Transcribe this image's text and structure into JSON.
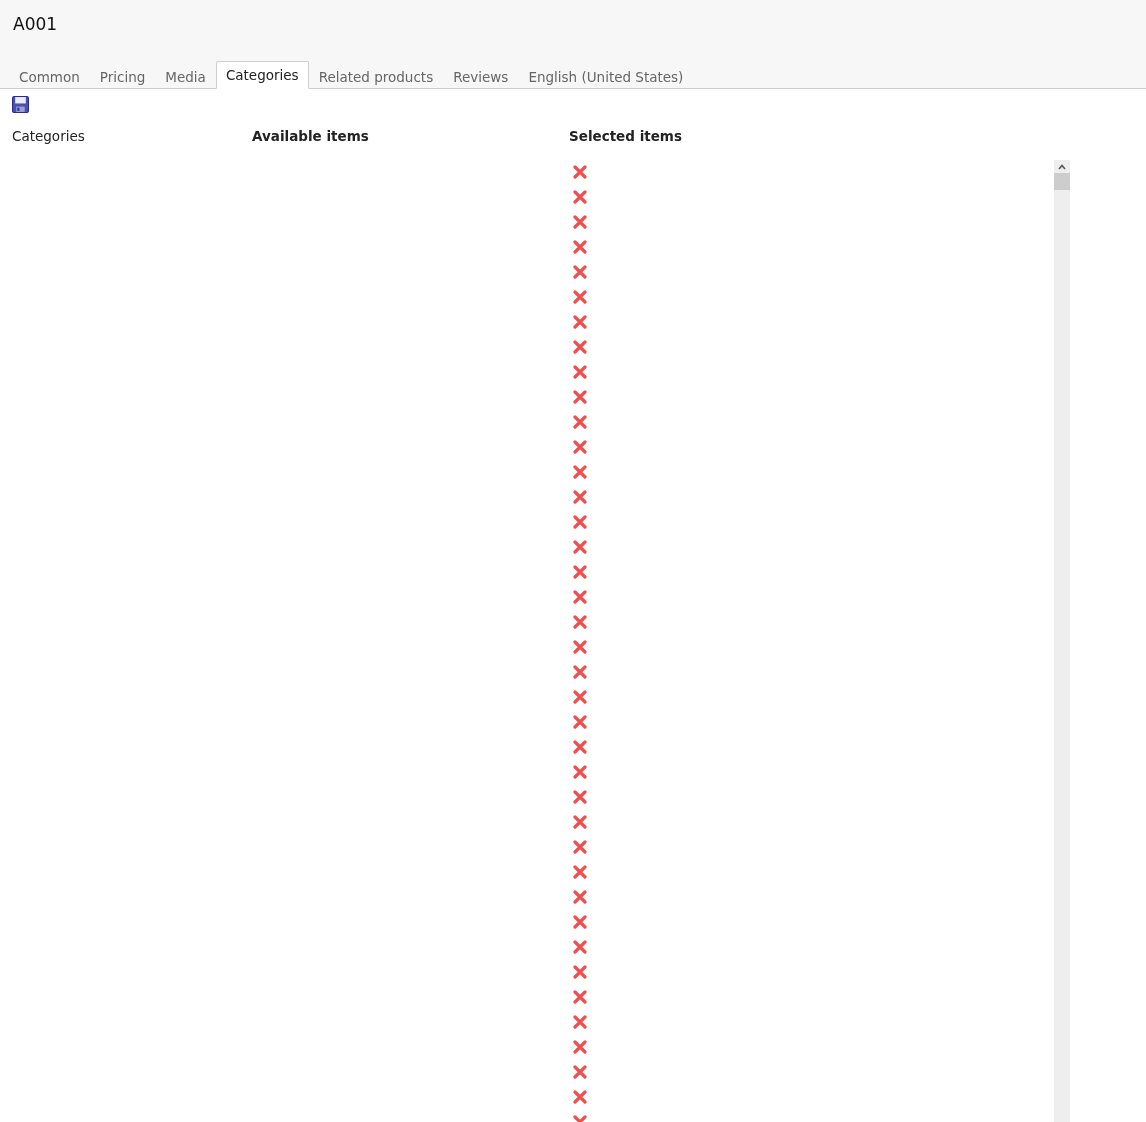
{
  "header": {
    "title": "A001"
  },
  "tabs": [
    {
      "label": "Common",
      "selected": false
    },
    {
      "label": "Pricing",
      "selected": false
    },
    {
      "label": "Media",
      "selected": false
    },
    {
      "label": "Categories",
      "selected": true
    },
    {
      "label": "Related products",
      "selected": false
    },
    {
      "label": "Reviews",
      "selected": false
    },
    {
      "label": "English (United States)",
      "selected": false
    }
  ],
  "columns": [
    {
      "label": "Categories",
      "kind": "plain"
    },
    {
      "label": "Available items",
      "kind": "heading"
    },
    {
      "label": "Selected items",
      "kind": "heading"
    }
  ],
  "selected_items": [
    {
      "removable": true
    },
    {
      "removable": true
    },
    {
      "removable": true
    },
    {
      "removable": true
    },
    {
      "removable": true
    },
    {
      "removable": true
    },
    {
      "removable": true
    },
    {
      "removable": true
    },
    {
      "removable": true
    },
    {
      "removable": true
    },
    {
      "removable": true
    },
    {
      "removable": true
    },
    {
      "removable": true
    },
    {
      "removable": true
    },
    {
      "removable": true
    },
    {
      "removable": true
    },
    {
      "removable": true
    },
    {
      "removable": true
    },
    {
      "removable": true
    },
    {
      "removable": true
    },
    {
      "removable": true
    },
    {
      "removable": true
    },
    {
      "removable": true
    },
    {
      "removable": true
    },
    {
      "removable": true
    },
    {
      "removable": true
    },
    {
      "removable": true
    },
    {
      "removable": true
    },
    {
      "removable": true
    },
    {
      "removable": true
    },
    {
      "removable": true
    },
    {
      "removable": true
    },
    {
      "removable": true
    },
    {
      "removable": true
    },
    {
      "removable": true
    },
    {
      "removable": true
    },
    {
      "removable": true
    },
    {
      "removable": true
    },
    {
      "removable": true
    }
  ]
}
